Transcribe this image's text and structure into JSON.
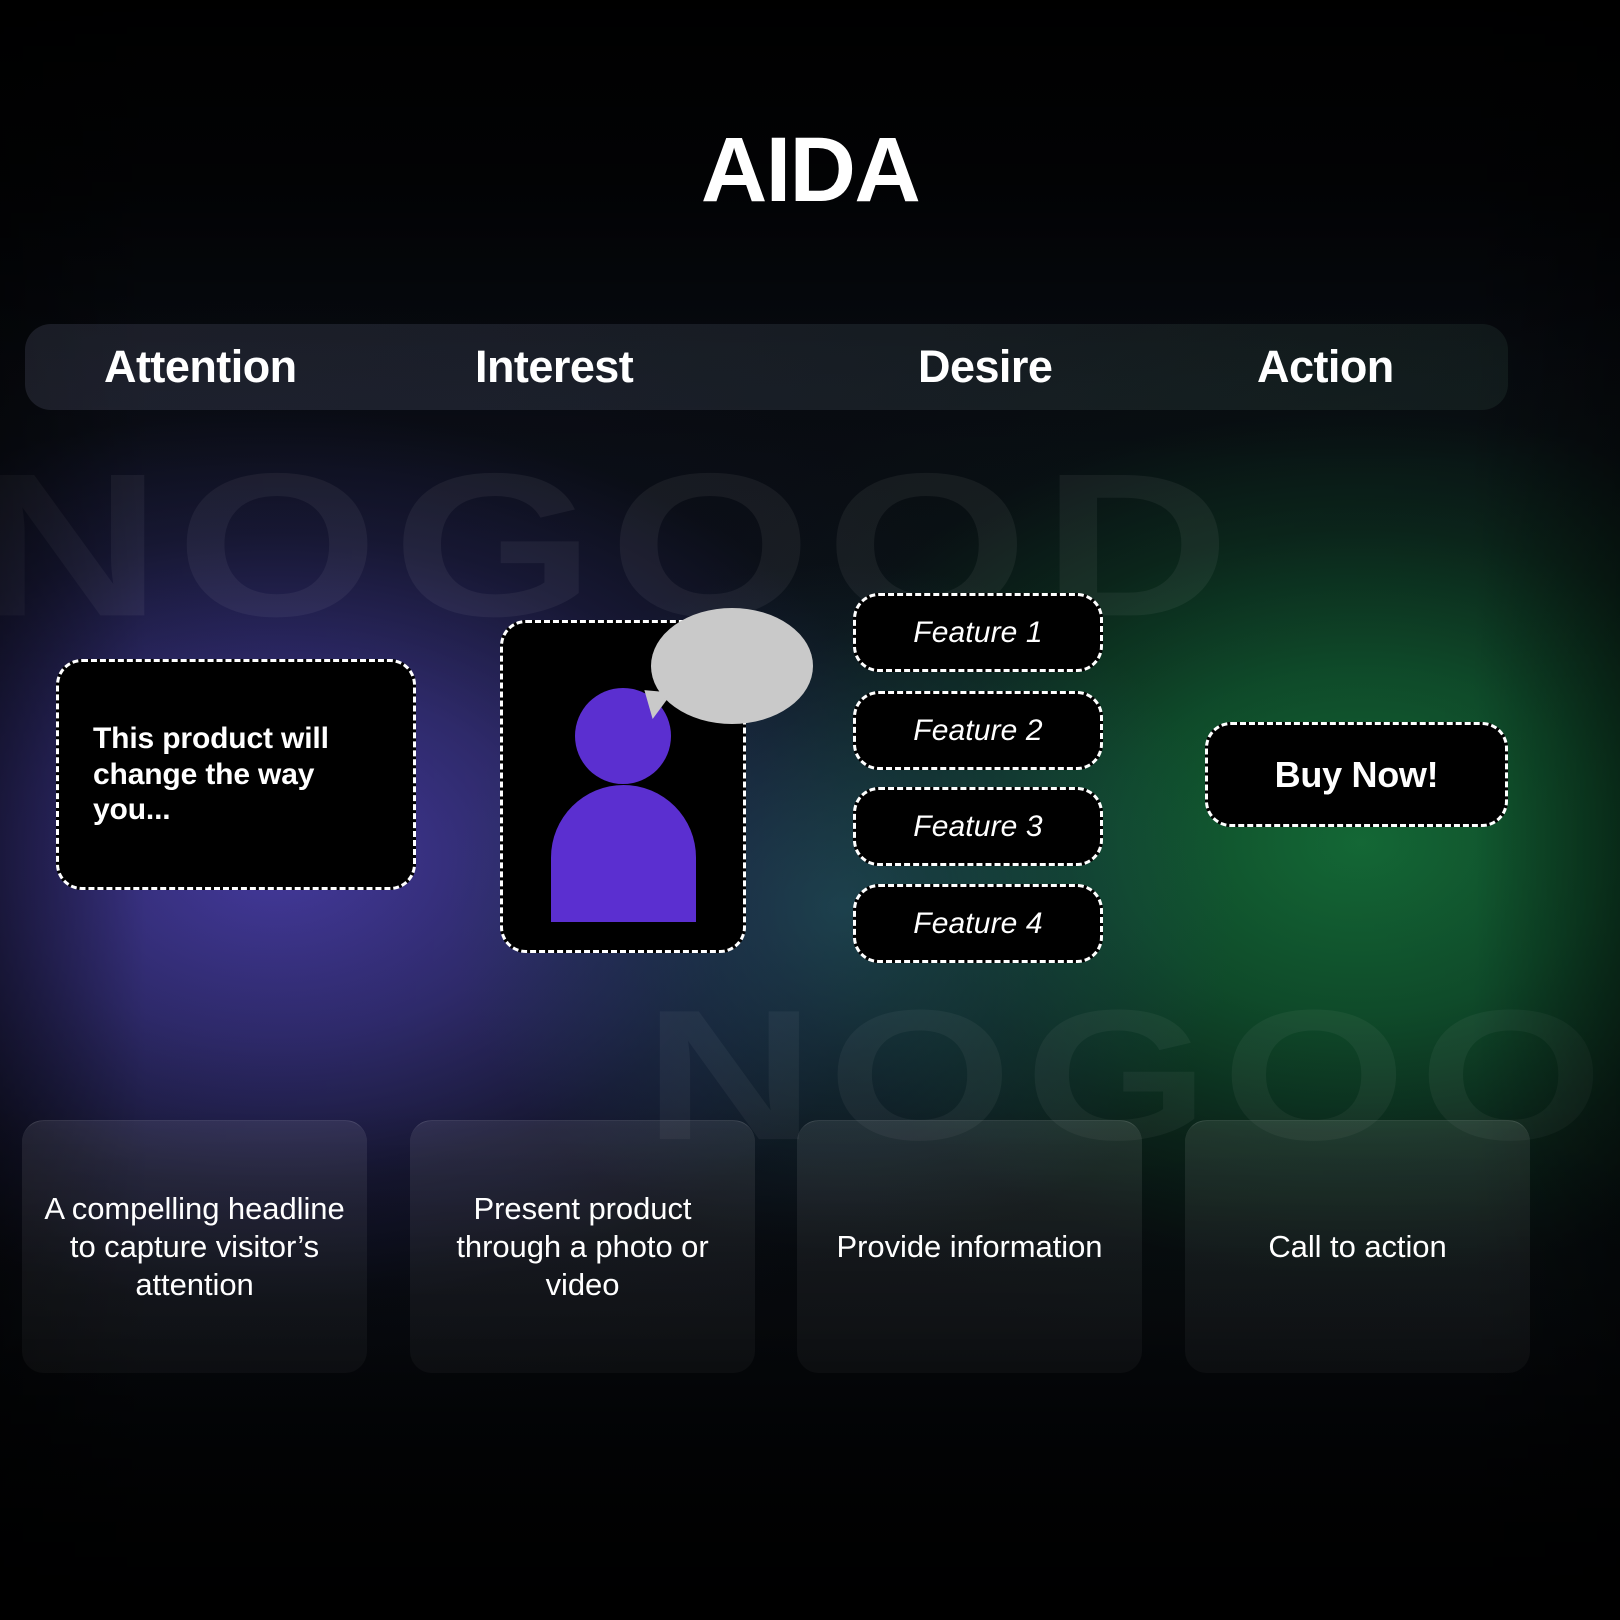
{
  "title": "AIDA",
  "watermarks": {
    "top": "NOGOOD",
    "bottom": "NOGOOD"
  },
  "header": {
    "stages": [
      {
        "label": "Attention"
      },
      {
        "label": "Interest"
      },
      {
        "label": "Desire"
      },
      {
        "label": "Action"
      }
    ]
  },
  "canvas": {
    "attention": {
      "headline": "This product will change the way you..."
    },
    "interest": {
      "person_icon": "person-icon",
      "speech_bubble_icon": "speech-bubble-icon"
    },
    "desire": {
      "features": [
        {
          "label": "Feature 1"
        },
        {
          "label": "Feature 2"
        },
        {
          "label": "Feature 3"
        },
        {
          "label": "Feature 4"
        }
      ]
    },
    "action": {
      "cta_label": "Buy Now!"
    }
  },
  "descriptions": [
    {
      "text": "A compelling headline to capture visitor’s attention"
    },
    {
      "text": "Present product through a photo or video"
    },
    {
      "text": "Provide information"
    },
    {
      "text": "Call to action"
    }
  ],
  "colors": {
    "accent_purple": "#5B2FD0",
    "bubble_gray": "#C9C9C9",
    "card_black": "#000000",
    "text_white": "#FFFFFF",
    "glow_left": "#4A3EAA",
    "glow_right": "#146E38"
  }
}
